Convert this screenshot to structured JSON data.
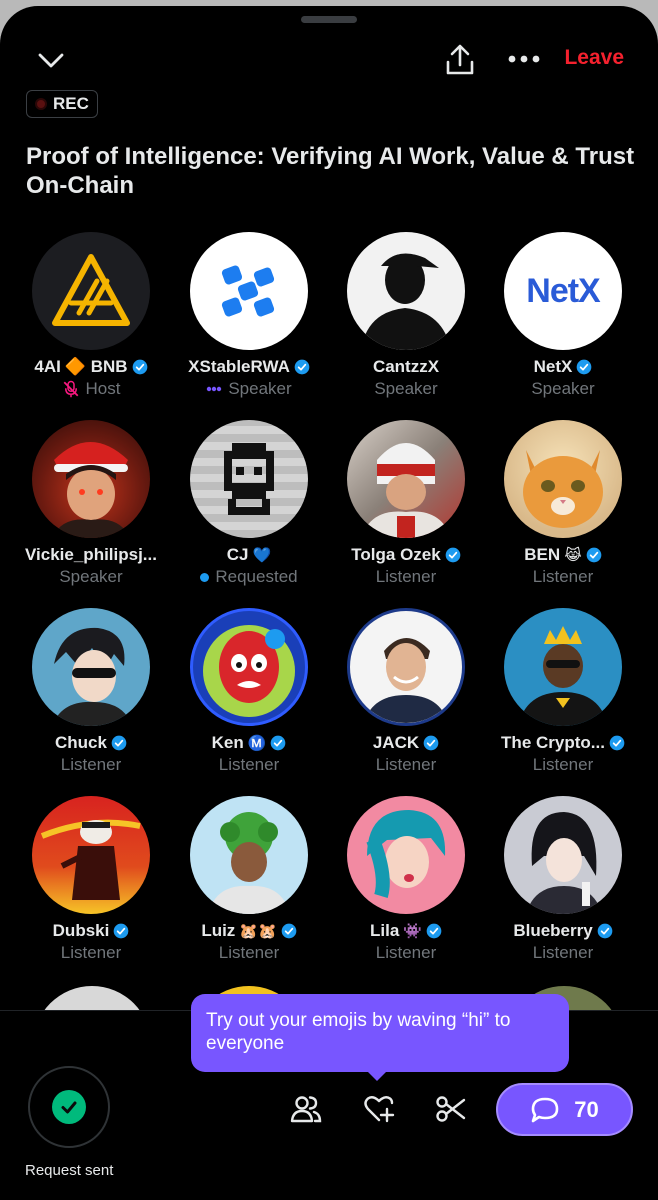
{
  "header": {
    "collapse_icon": "chevron-down-icon",
    "share_icon": "share-icon",
    "more_icon": "more-icon",
    "leave_label": "Leave"
  },
  "rec_badge": {
    "label": "REC"
  },
  "space": {
    "title": "Proof of Intelligence: Verifying AI Work, Value & Trust On-Chain"
  },
  "participants": [
    {
      "name": "4AI",
      "name_extra": "🔶 BNB",
      "verified": true,
      "role": "Host",
      "role_icon": "mic-off-icon"
    },
    {
      "name": "XStableRWA",
      "verified": true,
      "role": "Speaker",
      "role_icon": "speaking-dots-icon"
    },
    {
      "name": "CantzzX",
      "verified": false,
      "role": "Speaker"
    },
    {
      "name": "NetX",
      "verified": true,
      "role": "Speaker"
    },
    {
      "name": "Vickie_philipsj...",
      "verified": false,
      "role": "Speaker"
    },
    {
      "name": "CJ",
      "name_extra": "💙",
      "verified": false,
      "role": "Requested",
      "role_icon": "blue-dot-icon"
    },
    {
      "name": "Tolga Ozek",
      "verified": true,
      "role": "Listener"
    },
    {
      "name": "BEN",
      "name_extra": "😹",
      "verified": true,
      "role": "Listener"
    },
    {
      "name": "Chuck",
      "verified": true,
      "role": "Listener"
    },
    {
      "name": "Ken",
      "name_extra": "Ⓜ️",
      "verified": true,
      "role": "Listener"
    },
    {
      "name": "JACK",
      "verified": true,
      "role": "Listener"
    },
    {
      "name": "The Crypto...",
      "verified": true,
      "role": "Listener"
    },
    {
      "name": "Dubski",
      "verified": true,
      "role": "Listener"
    },
    {
      "name": "Luiz",
      "name_extra": "🐹🐹",
      "verified": true,
      "role": "Listener"
    },
    {
      "name": "Lila",
      "name_extra": "👾",
      "verified": true,
      "role": "Listener"
    },
    {
      "name": "Blueberry",
      "verified": true,
      "role": "Listener"
    }
  ],
  "avatar_logos": {
    "netx": "NetX"
  },
  "bottom_bar": {
    "request_status": "Request sent",
    "tooltip": "Try out your emojis by waving “hi” to everyone",
    "people_icon": "people-icon",
    "react_icon": "heart-plus-icon",
    "clip_icon": "scissors-icon",
    "chat_icon": "chat-bubble-icon",
    "chat_count": "70"
  },
  "colors": {
    "background": "#000000",
    "accent_purple": "#7856ff",
    "leave_red": "#f4212e",
    "verified_blue": "#1d9bf0",
    "muted_text": "#71767b",
    "success_green": "#00ba7c"
  }
}
